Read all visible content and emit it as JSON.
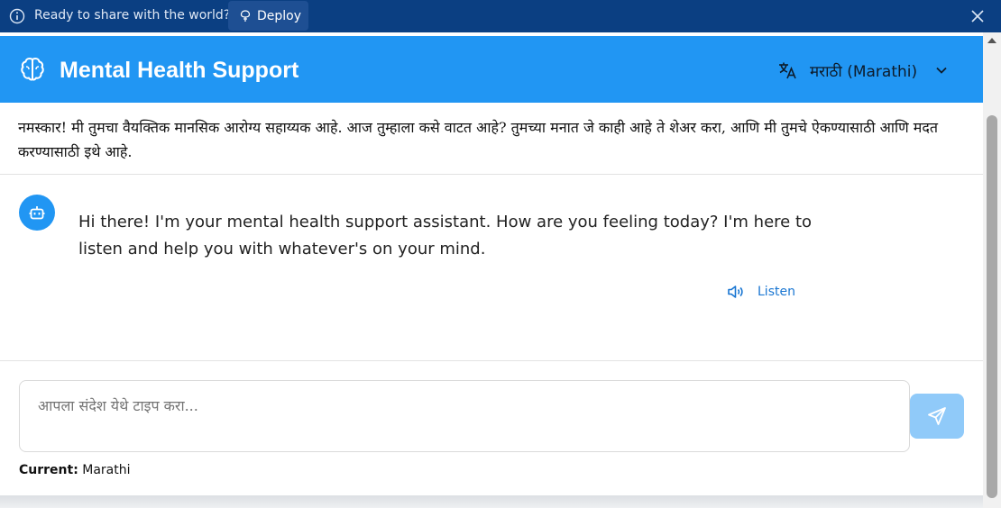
{
  "banner": {
    "message": "Ready to share with the world?",
    "deploy_label": "Deploy"
  },
  "header": {
    "title": "Mental Health Support",
    "language_selected": "मराठी (Marathi)"
  },
  "greeting": "नमस्कार! मी तुमचा वैयक्तिक मानसिक आरोग्य सहाय्यक आहे. आज तुम्हाला कसे वाटत आहे? तुमच्या मनात जे काही आहे ते शेअर करा, आणि मी तुमचे ऐकण्यासाठी आणि मदत करण्यासाठी इथे आहे.",
  "messages": [
    {
      "role": "assistant",
      "text": "Hi there! I'm your mental health support assistant. How are you feeling today? I'm here to listen and help you with whatever's on your mind.",
      "listen_label": "Listen"
    }
  ],
  "composer": {
    "placeholder": "आपला संदेश येथे टाइप करा...",
    "value": ""
  },
  "status": {
    "current_label": "Current:",
    "current_value": "Marathi"
  },
  "icons": {
    "banner": "info-icon",
    "deploy": "deploy-icon",
    "close": "close-icon",
    "brand": "brain-icon",
    "translate": "translate-icon",
    "dropdown": "chevron-down-icon",
    "bot": "robot-icon",
    "speaker": "speaker-icon",
    "send": "send-icon"
  },
  "colors": {
    "banner_bg": "#0b3f82",
    "header_bg": "#2196f3",
    "accent": "#1976d2",
    "send_disabled": "#90caf9"
  }
}
